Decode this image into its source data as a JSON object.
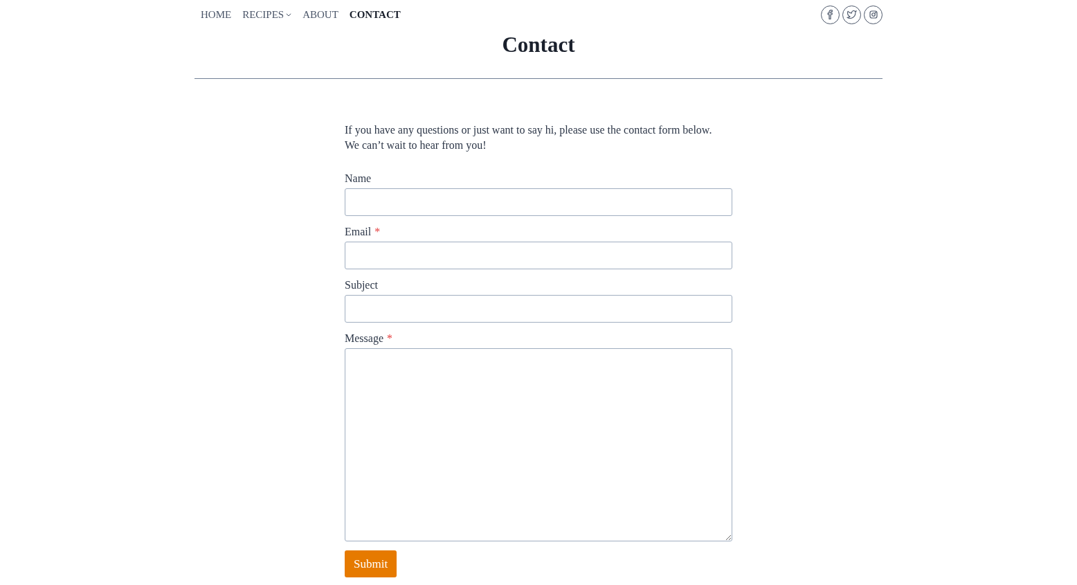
{
  "nav": {
    "items": [
      {
        "label": "HOME",
        "selected": false,
        "has_dropdown": false
      },
      {
        "label": "RECIPES",
        "selected": false,
        "has_dropdown": true
      },
      {
        "label": "ABOUT",
        "selected": false,
        "has_dropdown": false
      },
      {
        "label": "CONTACT",
        "selected": true,
        "has_dropdown": false
      }
    ]
  },
  "page": {
    "title": "Contact"
  },
  "intro": "If you have any questions or just want to say hi, please use the contact form below.\nWe can’t wait to hear from you!",
  "form": {
    "fields": [
      {
        "kind": "input",
        "label": "Name"
      },
      {
        "kind": "input",
        "label": "Email",
        "required_mark": "*"
      },
      {
        "kind": "input",
        "label": "Subject"
      },
      {
        "kind": "textarea",
        "label": "Message",
        "required_mark": "*"
      }
    ],
    "submit": "Submit"
  }
}
